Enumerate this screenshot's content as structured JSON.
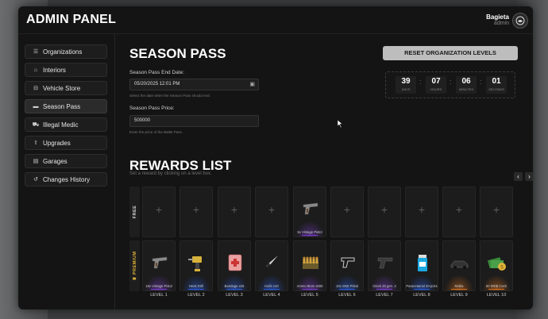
{
  "app": {
    "title": "ADMIN PANEL"
  },
  "user": {
    "name": "Bagieta",
    "role": "admin"
  },
  "sidebar": {
    "items": [
      {
        "label": "Organizations",
        "icon": "list-icon",
        "glyph": "☰",
        "active": false
      },
      {
        "label": "Interiors",
        "icon": "home-icon",
        "glyph": "⌂",
        "active": false
      },
      {
        "label": "Vehicle Store",
        "icon": "car-icon",
        "glyph": "⊟",
        "active": false
      },
      {
        "label": "Season Pass",
        "icon": "ticket-icon",
        "glyph": "▬",
        "active": true
      },
      {
        "label": "Illegal Medic",
        "icon": "ambulance-icon",
        "glyph": "⛟",
        "active": false
      },
      {
        "label": "Upgrades",
        "icon": "upgrade-icon",
        "glyph": "⇧",
        "active": false
      },
      {
        "label": "Garages",
        "icon": "garage-icon",
        "glyph": "▤",
        "active": false
      },
      {
        "label": "Changes History",
        "icon": "history-icon",
        "glyph": "↺",
        "active": false
      }
    ]
  },
  "season": {
    "title": "SEASON PASS",
    "end_label": "Season Pass End Date:",
    "end_value": "05/20/2025 12:01 PM",
    "end_hint": "Select the date when the Season Pass should end.",
    "price_label": "Season Pass Price:",
    "price_value": "500000",
    "price_hint": "Enter the price of the Battle Pass.",
    "reset_label": "RESET ORGANIZATION LEVELS"
  },
  "countdown": [
    {
      "value": "39",
      "unit": "DAYS"
    },
    {
      "value": "07",
      "unit": "HOURS"
    },
    {
      "value": "06",
      "unit": "MINUTES"
    },
    {
      "value": "01",
      "unit": "SECONDS"
    }
  ],
  "rewards": {
    "title": "REWARDS LIST",
    "subtitle": "Set a reward by clicking on a level box.",
    "free_label": "FREE",
    "premium_label": "PREMIUM",
    "free": [
      {
        "name": ""
      },
      {
        "name": ""
      },
      {
        "name": ""
      },
      {
        "name": ""
      },
      {
        "name": "5x Vintage Pistol",
        "icon": "pistol-icon"
      },
      {
        "name": ""
      },
      {
        "name": ""
      },
      {
        "name": ""
      },
      {
        "name": ""
      },
      {
        "name": ""
      }
    ],
    "premium": [
      {
        "name": "15x Vintage Pistol",
        "icon": "pistol-icon",
        "color": "#7a3cc8"
      },
      {
        "name": "Heist Drill",
        "icon": "drill-icon",
        "color": "#2c5bd8"
      },
      {
        "name": "Bandage x25",
        "icon": "bandage-icon",
        "color": "#2c5bd8"
      },
      {
        "name": "Knife x10",
        "icon": "knife-icon",
        "color": "#2c5bd8"
      },
      {
        "name": "Ammo 9mm x500",
        "icon": "ammo-icon",
        "color": "#7a3cc8"
      },
      {
        "name": "10x SNS Pistol",
        "icon": "sns-pistol-icon",
        "color": "#2c5bd8"
      },
      {
        "name": "Glock 20 gen. 4",
        "icon": "glock-icon",
        "color": "#7a3cc8"
      },
      {
        "name": "Paracetamol 20-pcks",
        "icon": "pill-bottle-icon",
        "color": "#2c5bd8"
      },
      {
        "name": "Rebla",
        "icon": "car-icon",
        "color": "#d26e1e"
      },
      {
        "name": "50 000$ Cash",
        "icon": "cash-icon",
        "color": "#d26e1e"
      }
    ],
    "levels": [
      "LEVEL 1",
      "LEVEL 2",
      "LEVEL 3",
      "LEVEL 4",
      "LEVEL 5",
      "LEVEL 6",
      "LEVEL 7",
      "LEVEL 8",
      "LEVEL 9",
      "LEVEL 10"
    ],
    "prev_label": "‹",
    "next_label": "›",
    "plus_label": "+"
  }
}
